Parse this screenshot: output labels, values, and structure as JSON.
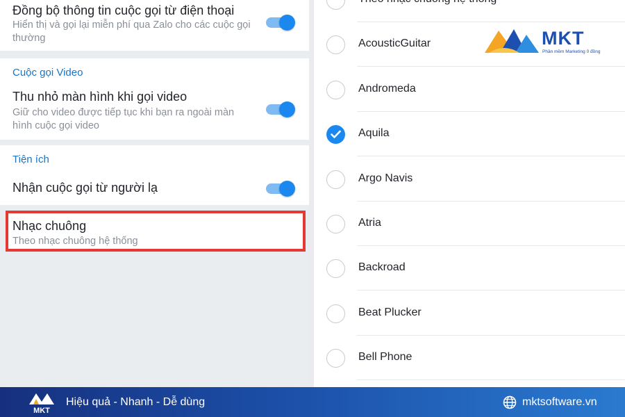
{
  "settings": {
    "sync_call": {
      "title": "Đồng bộ thông tin cuộc gọi từ điện thoại",
      "subtitle": "Hiển thị và gọi lại miễn phí qua Zalo cho các cuộc gọi thường",
      "enabled": true
    },
    "video_section": {
      "heading": "Cuộc gọi Video",
      "minimize": {
        "title": "Thu nhỏ màn hình khi gọi video",
        "subtitle": "Giữ cho video được tiếp tục khi bạn ra ngoài màn hình cuộc gọi video",
        "enabled": true
      }
    },
    "utility_section": {
      "heading": "Tiện ích",
      "strangers": {
        "title": "Nhận cuộc gọi từ người lạ",
        "enabled": true
      },
      "ringtone": {
        "title": "Nhạc chuông",
        "subtitle": "Theo nhạc chuông hệ thống"
      }
    }
  },
  "ringtone_list": {
    "options": [
      {
        "label": "Theo nhạc chuông hệ thống",
        "checked": false
      },
      {
        "label": "AcousticGuitar",
        "checked": false
      },
      {
        "label": "Andromeda",
        "checked": false
      },
      {
        "label": "Aquila",
        "checked": true
      },
      {
        "label": "Argo Navis",
        "checked": false
      },
      {
        "label": "Atria",
        "checked": false
      },
      {
        "label": "Backroad",
        "checked": false
      },
      {
        "label": "Beat Plucker",
        "checked": false
      },
      {
        "label": "Bell Phone",
        "checked": false
      }
    ]
  },
  "watermark": {
    "brand": "MKT",
    "tagline": "Phần mềm Marketing 0 đồng"
  },
  "footer": {
    "brand": "MKT",
    "slogan": "Hiệu quả - Nhanh - Dễ dùng",
    "website": "mktsoftware.vn",
    "globe_icon": "globe-icon"
  },
  "colors": {
    "accent": "#1a88ef",
    "section_heading": "#1b74c5",
    "highlight_border": "#e53935",
    "footer_start": "#16307e",
    "footer_end": "#2a7ad0"
  }
}
